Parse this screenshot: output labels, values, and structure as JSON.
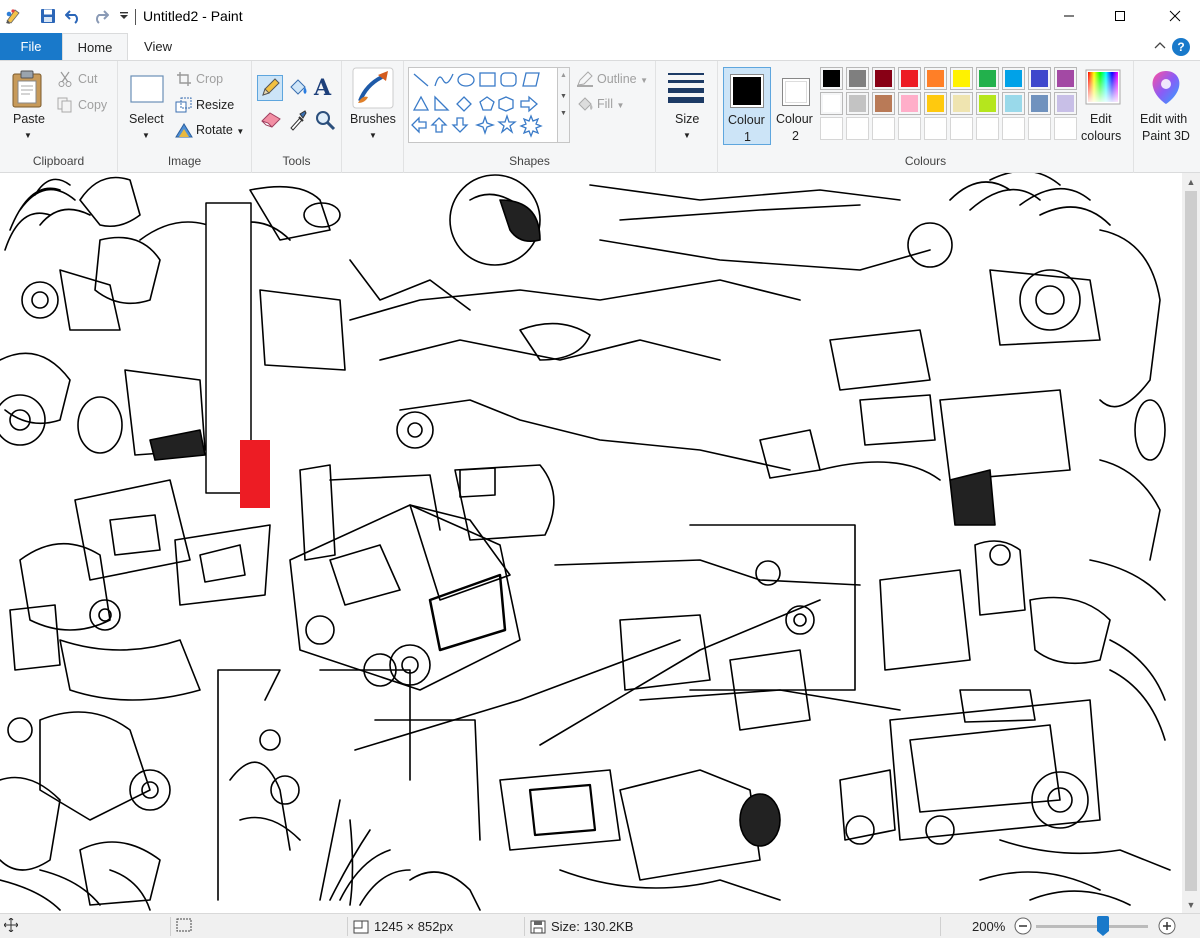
{
  "titlebar": {
    "title": "Untitled2 - Paint",
    "quick_access": [
      "paint-app-icon",
      "save-icon",
      "undo-icon",
      "redo-icon",
      "customize-qat-icon"
    ],
    "window_controls": [
      "minimize-icon",
      "maximize-icon",
      "close-icon"
    ]
  },
  "tabs": {
    "file": "File",
    "home": "Home",
    "view": "View",
    "help": "?"
  },
  "clipboard": {
    "paste": "Paste",
    "cut": "Cut",
    "copy": "Copy",
    "group": "Clipboard"
  },
  "image": {
    "select": "Select",
    "crop": "Crop",
    "resize": "Resize",
    "rotate": "Rotate",
    "group": "Image"
  },
  "tools": {
    "group": "Tools",
    "items": [
      "pencil-icon",
      "fill-icon",
      "text-icon",
      "eraser-icon",
      "color-picker-icon",
      "magnifier-icon"
    ]
  },
  "brushes": {
    "label": "Brushes"
  },
  "shapes": {
    "group": "Shapes",
    "outline": "Outline",
    "fill": "Fill"
  },
  "size": {
    "label": "Size"
  },
  "colours": {
    "colour1_label": "Colour",
    "colour1_num": "1",
    "colour2_label": "Colour",
    "colour2_num": "2",
    "colour1_value": "#000000",
    "colour2_value": "#ffffff",
    "palette_row1": [
      "#000000",
      "#7f7f7f",
      "#880015",
      "#ed1c24",
      "#ff7f27",
      "#fff200",
      "#22b14c",
      "#00a2e8",
      "#3f48cc",
      "#a349a4"
    ],
    "palette_row2": [
      "#ffffff",
      "#c3c3c3",
      "#b97a57",
      "#ffaec9",
      "#ffc90e",
      "#efe4b0",
      "#b5e61d",
      "#99d9ea",
      "#7092be",
      "#c8bfe7"
    ],
    "edit_label_1": "Edit",
    "edit_label_2": "colours",
    "group": "Colours"
  },
  "paint3d": {
    "line1": "Edit with",
    "line2": "Paint 3D"
  },
  "canvas": {
    "accent_red": "#ed1c24"
  },
  "statusbar": {
    "dimensions": "1245 × 852px",
    "size": "Size: 130.2KB",
    "zoom": "200%"
  }
}
